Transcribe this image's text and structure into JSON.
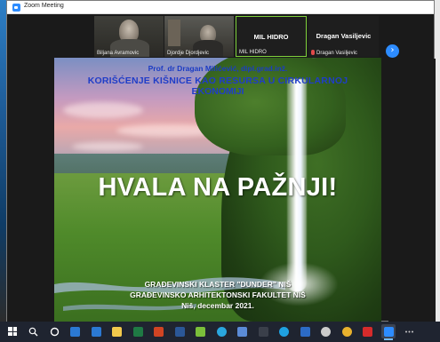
{
  "window": {
    "title": "Zoom Meeting"
  },
  "participants": [
    {
      "name": "Biljana Avramovic",
      "type": "video"
    },
    {
      "name": "Djordje Djordjevic",
      "type": "video"
    },
    {
      "name": "MIL HIDRO",
      "center_label": "MIL HIDRO",
      "type": "name-only",
      "active": true
    },
    {
      "name": "Dragan Vasiljevic",
      "center_label": "Dragan Vasiljevic",
      "type": "name-only",
      "muted": true
    }
  ],
  "strip_controls": {
    "next_icon": "chevron-right-icon"
  },
  "slide": {
    "author": "Prof. dr Dragan Milićević, dipl.grad.inž.",
    "title_line1": "KORIŠĆENJE KIŠNICE KAO RESURSA U CIRKULARNOJ",
    "title_line2": "EKONOMIJI",
    "thanks": "HVALA NA PAŽNJI!",
    "footer_line1": "GRAĐEVINSKI KLASTER \"DUNDER\" NIŠ",
    "footer_line2": "GRAĐEVINSKO ARHITEKTONSKI FAKULTET NIŠ",
    "footer_line3": "Niš, decembar 2021.",
    "colors": {
      "title": "#1f3dc8",
      "thanks": "#ffffff"
    }
  },
  "taskbar": {
    "items": [
      {
        "icon": "windows-start-icon",
        "color": "#ffffff"
      },
      {
        "icon": "search-icon",
        "color": "#ffffff"
      },
      {
        "icon": "cortana-icon",
        "color": "#ffffff"
      },
      {
        "icon": "mail-icon",
        "color": "#2b79d3"
      },
      {
        "icon": "store-icon",
        "color": "#2b79d3"
      },
      {
        "icon": "file-explorer-icon",
        "color": "#f2c94c"
      },
      {
        "icon": "excel-icon",
        "color": "#1f7a44"
      },
      {
        "icon": "powerpoint-icon",
        "color": "#d04423"
      },
      {
        "icon": "word-icon",
        "color": "#2b5797"
      },
      {
        "icon": "paint-icon",
        "color": "#7bbf3a"
      },
      {
        "icon": "edge-icon",
        "color": "#2aa7df"
      },
      {
        "icon": "photos-icon",
        "color": "#5b8bd6"
      },
      {
        "icon": "calculator-icon",
        "color": "#3a3f4a"
      },
      {
        "icon": "skype-icon",
        "color": "#1fa1e1"
      },
      {
        "icon": "outlook-icon",
        "color": "#2c6bc6"
      },
      {
        "icon": "settings-icon",
        "color": "#cccccc"
      },
      {
        "icon": "chrome-icon",
        "color": "#e8b12d"
      },
      {
        "icon": "acrobat-icon",
        "color": "#d62b2b"
      },
      {
        "icon": "zoom-icon",
        "color": "#2d8cff",
        "active": true
      },
      {
        "icon": "more-icon",
        "color": "#cccccc"
      }
    ]
  }
}
